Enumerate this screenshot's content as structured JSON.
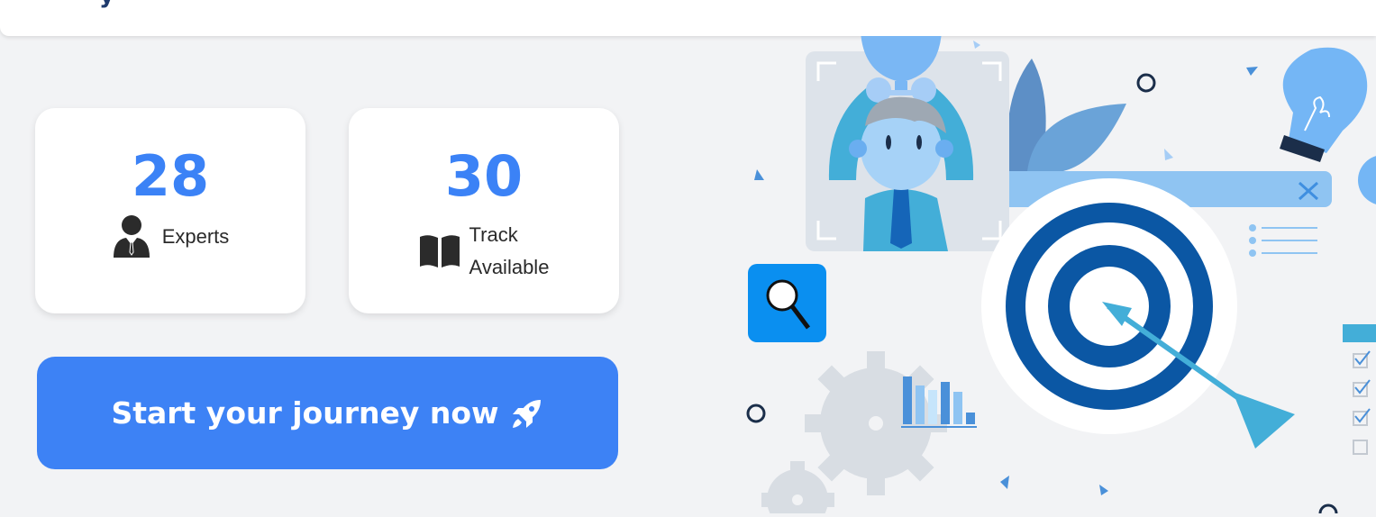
{
  "header": {
    "logo_fragment": "y"
  },
  "stats": [
    {
      "value": "28",
      "label": "Experts",
      "icon": "person-in-suit-icon"
    },
    {
      "value": "30",
      "label_line1": "Track",
      "label_line2": "Available",
      "icon": "open-book-icon"
    }
  ],
  "cta": {
    "label": "Start your journey now",
    "icon": "rocket-icon"
  },
  "colors": {
    "accent": "#3b82f6",
    "button": "#3d82f5",
    "background": "#f2f3f5",
    "target_dark": "#0b57a4",
    "illustration_light": "#74b6f5"
  },
  "illustration": {
    "name": "career-goal-illustration",
    "elements": [
      "trophy-person-icon",
      "target-icon",
      "arrow-icon",
      "lightbulb-icon",
      "magnifier-icon",
      "bar-chart-icon",
      "gear-icon",
      "checklist-icon"
    ]
  }
}
